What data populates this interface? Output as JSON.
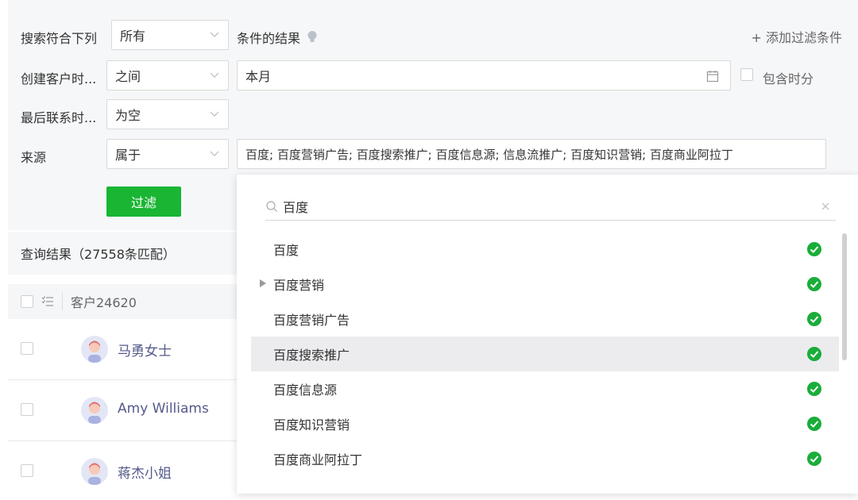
{
  "filters": {
    "match_prefix": "搜索符合下列",
    "match_value": "所有",
    "match_suffix": "条件的结果",
    "add_filter": "+ 添加过滤条件",
    "rows": [
      {
        "label": "创建客户时...",
        "operator": "之间",
        "value": "本月",
        "include_time_label": "包含时分"
      },
      {
        "label": "最后联系时...",
        "operator": "为空"
      },
      {
        "label": "来源",
        "operator": "属于",
        "value": "百度; 百度营销广告; 百度搜索推广; 百度信息源; 信息流推广; 百度知识营销; 百度商业阿拉丁"
      }
    ],
    "filter_button": "过滤"
  },
  "results": {
    "summary": "查询结果（27558条匹配）",
    "column_customer": "客户24620",
    "rows": [
      {
        "name": "马勇女士"
      },
      {
        "name": "Amy Williams"
      },
      {
        "name": "蒋杰小姐"
      }
    ]
  },
  "dropdown": {
    "search_value": "百度",
    "options": [
      {
        "label": "百度",
        "checked": true,
        "expandable": false,
        "highlighted": false
      },
      {
        "label": "百度营销",
        "checked": true,
        "expandable": true,
        "highlighted": false
      },
      {
        "label": "百度营销广告",
        "checked": true,
        "expandable": false,
        "highlighted": false
      },
      {
        "label": "百度搜索推广",
        "checked": true,
        "expandable": false,
        "highlighted": true
      },
      {
        "label": "百度信息源",
        "checked": true,
        "expandable": false,
        "highlighted": false
      },
      {
        "label": "百度知识营销",
        "checked": true,
        "expandable": false,
        "highlighted": false
      },
      {
        "label": "百度商业阿拉丁",
        "checked": true,
        "expandable": false,
        "highlighted": false
      }
    ]
  },
  "colors": {
    "accent_green": "#19b533",
    "check_green": "#1aad3a",
    "name_link": "#555a8a"
  }
}
